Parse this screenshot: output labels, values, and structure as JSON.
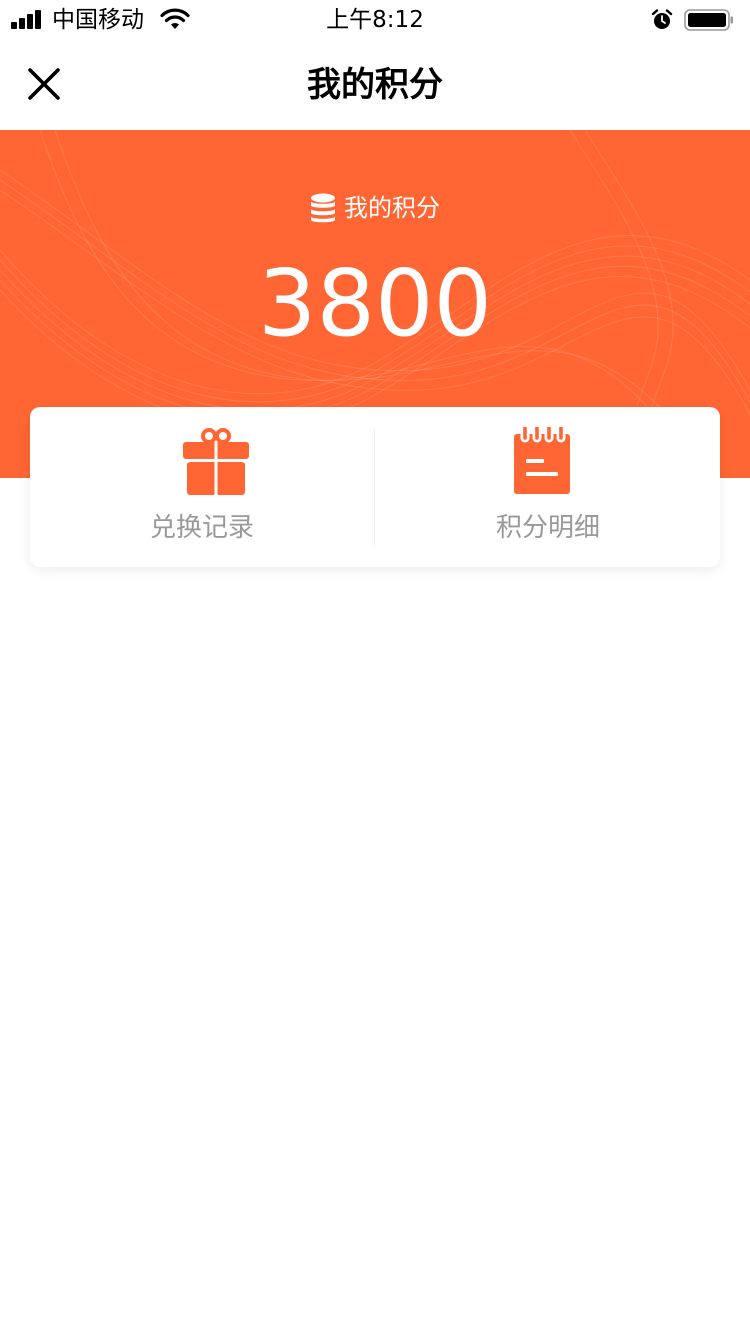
{
  "status_bar": {
    "carrier": "中国移动",
    "time": "上午8:12"
  },
  "nav": {
    "title": "我的积分",
    "close_icon": "close-icon"
  },
  "hero": {
    "label": "我的积分",
    "points": "3800",
    "icon": "coin-stack-icon",
    "background_color": "#ff6633"
  },
  "actions": [
    {
      "label": "兑换记录",
      "icon": "gift-icon"
    },
    {
      "label": "积分明细",
      "icon": "notepad-icon"
    }
  ],
  "colors": {
    "accent": "#ff6633",
    "label_gray": "#999999"
  }
}
